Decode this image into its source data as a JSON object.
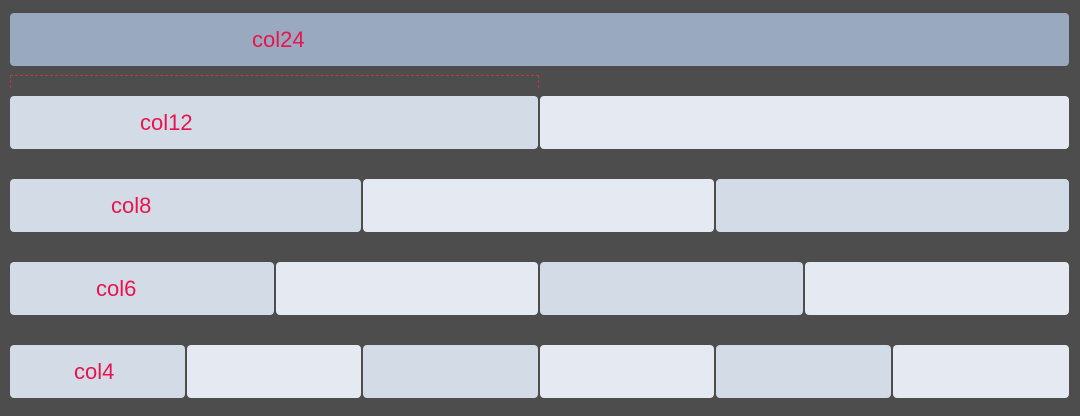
{
  "colors": {
    "background": "#4e4d4d",
    "full_row": "#99a9bf",
    "cell_dark": "#d3dce6",
    "cell_light": "#e5e9f2",
    "label": "#e8144f",
    "guide": "#c03a3a"
  },
  "rows": [
    {
      "label": "col24",
      "columns": 1,
      "span": 24
    },
    {
      "label": "col12",
      "columns": 2,
      "span": 12
    },
    {
      "label": "col8",
      "columns": 3,
      "span": 8
    },
    {
      "label": "col6",
      "columns": 4,
      "span": 6
    },
    {
      "label": "col4",
      "columns": 6,
      "span": 4
    }
  ]
}
